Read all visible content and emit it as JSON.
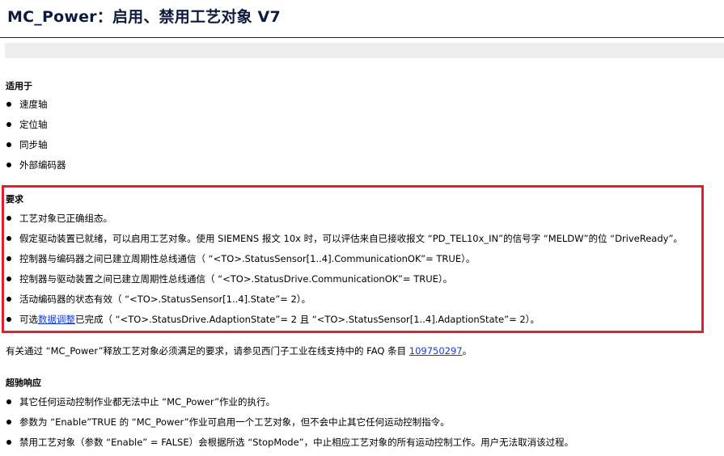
{
  "title": "MC_Power：启用、禁用工艺对象 V7",
  "applies_to": {
    "heading": "适用于",
    "items": [
      "速度轴",
      "定位轴",
      "同步轴",
      "外部编码器"
    ]
  },
  "requirements": {
    "heading": "要求",
    "items": [
      {
        "text": "工艺对象已正确组态。"
      },
      {
        "text": "假定驱动装置已就绪，可以启用工艺对象。使用 SIEMENS 报文 10x 时，可以评估来自已接收报文 “PD_TEL10x_IN”的信号字 “MELDW”的位 “DriveReady”。"
      },
      {
        "text": "控制器与编码器之间已建立周期性总线通信（ “<TO>.StatusSensor[1..4].CommunicationOK”= TRUE）。"
      },
      {
        "text": "控制器与驱动装置之间已建立周期性总线通信（ “<TO>.StatusDrive.CommunicationOK”= TRUE）。"
      },
      {
        "text": "活动编码器的状态有效（ “<TO>.StatusSensor[1..4].State”= 2）。"
      },
      {
        "prefix": "可选",
        "link": "数据调整",
        "suffix": "已完成（ “<TO>.StatusDrive.AdaptionState”= 2 且 “<TO>.StatusSensor[1..4].AdaptionState”= 2）。"
      }
    ]
  },
  "note": {
    "text": "有关通过 “MC_Power”释放工艺对象必须满足的要求，请参见西门子工业在线支持中的 FAQ 条目 ",
    "faq_link": "109750297",
    "end": "。"
  },
  "override": {
    "heading": "超驰响应",
    "items": [
      "其它任何运动控制作业都无法中止 “MC_Power”作业的执行。",
      "参数为 “Enable”TRUE 的 “MC_Power”作业可启用一个工艺对象，但不会中止其它任何运动控制指令。",
      "禁用工艺对象（参数 “Enable” = FALSE）会根据所选 “StopMode”，中止相应工艺对象的所有运动控制工作。用户无法取消该过程。"
    ]
  }
}
